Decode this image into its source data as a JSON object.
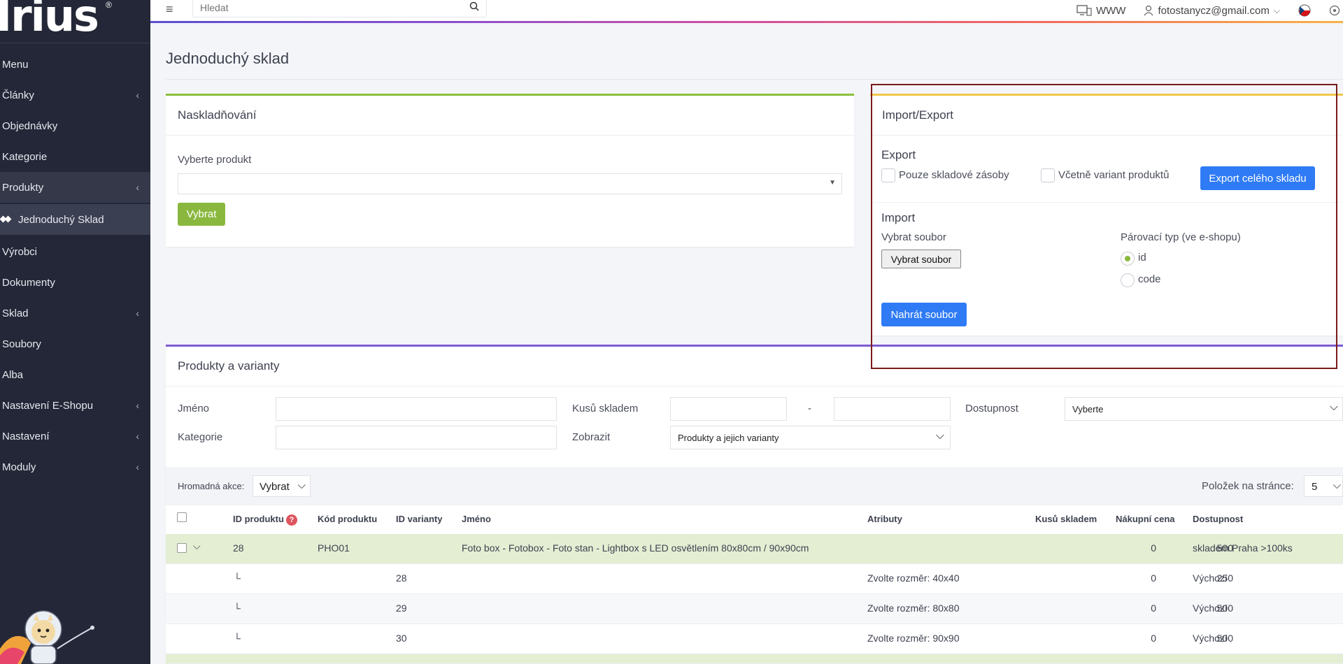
{
  "logo": {
    "text": "Irius",
    "mark": "®"
  },
  "sidebar": {
    "items": [
      {
        "label": "Menu",
        "chevron": false
      },
      {
        "label": "Články",
        "chevron": true
      },
      {
        "label": "Objednávky",
        "chevron": false
      },
      {
        "label": "Kategorie",
        "chevron": false
      },
      {
        "label": "Produkty",
        "chevron": true
      },
      {
        "label": "Jednoduchý Sklad",
        "chevron": false
      },
      {
        "label": "Výrobci",
        "chevron": false
      },
      {
        "label": "Dokumenty",
        "chevron": false
      },
      {
        "label": "Sklad",
        "chevron": true
      },
      {
        "label": "Soubory",
        "chevron": false
      },
      {
        "label": "Alba",
        "chevron": false
      },
      {
        "label": "Nastavení E-Shopu",
        "chevron": true
      },
      {
        "label": "Nastavení",
        "chevron": true
      },
      {
        "label": "Moduly",
        "chevron": true
      }
    ]
  },
  "topbar": {
    "search_placeholder": "Hledat",
    "www_label": "WWW",
    "user_email": "fotostanycz@gmail.com"
  },
  "page": {
    "title": "Jednoduchý sklad"
  },
  "stock_card": {
    "title": "Naskladňování",
    "product_label": "Vyberte produkt",
    "select_button": "Vybrat"
  },
  "import_export": {
    "title": "Import/Export",
    "export_heading": "Export",
    "only_stock_label": "Pouze skladové zásoby",
    "incl_variants_label": "Včetně variant produktů",
    "export_button": "Export celého skladu",
    "import_heading": "Import",
    "choose_file_label": "Vybrat soubor",
    "choose_file_button": "Vybrat soubor",
    "pairing_label": "Párovací typ (ve e-shopu)",
    "pairing_options": [
      "id",
      "code"
    ],
    "pairing_selected": "id",
    "upload_button": "Nahrát soubor"
  },
  "products": {
    "title": "Produkty a varianty",
    "filters": {
      "name_label": "Jméno",
      "category_label": "Kategorie",
      "stock_label": "Kusů skladem",
      "range_sep": "-",
      "show_label": "Zobrazit",
      "show_value": "Produkty a jejich varianty",
      "availability_label": "Dostupnost",
      "availability_value": "Vyberte"
    },
    "bulk_label": "Hromadná akce:",
    "bulk_value": "Vybrat",
    "per_page_label": "Položek na stránce:",
    "per_page_value": "5",
    "columns": [
      "ID produktu",
      "Kód produktu",
      "ID varianty",
      "Jméno",
      "Atributy",
      "Kusů skladem",
      "Nákupní cena",
      "Dostupnost"
    ],
    "rows": [
      {
        "id": "28",
        "code": "PHO01",
        "variant": "",
        "name": "Foto box - Fotobox - Foto stan - Lightbox s LED osvětlením 80x80cm / 90x90cm",
        "attrs": "",
        "stock": "0",
        "price": "500",
        "avail": "skladem Praha >100ks",
        "main": true
      },
      {
        "id": "",
        "code": "",
        "variant": "28",
        "name": "",
        "attrs": "Zvolte rozměr: 40x40",
        "stock": "0",
        "price": "250",
        "avail": "Výchozí",
        "main": false
      },
      {
        "id": "",
        "code": "",
        "variant": "29",
        "name": "",
        "attrs": "Zvolte rozměr: 80x80",
        "stock": "0",
        "price": "500",
        "avail": "Výchozí",
        "main": false
      },
      {
        "id": "",
        "code": "",
        "variant": "30",
        "name": "",
        "attrs": "Zvolte rozměr: 90x90",
        "stock": "0",
        "price": "500",
        "avail": "Výchozí",
        "main": false
      }
    ],
    "variant_marker": "└"
  },
  "colors": {
    "sidebar_bg": "#232737",
    "accent_green": "#8ab83f",
    "accent_blue": "#2f7bf5",
    "highlight_frame": "#7a1a1a"
  }
}
